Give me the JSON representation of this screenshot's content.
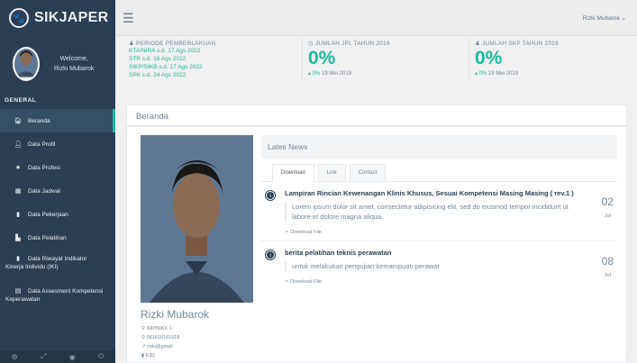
{
  "brand": {
    "title": "SIKJAPER"
  },
  "profile": {
    "welcome": "Welcome,",
    "name": "Rizki Mubarok"
  },
  "sidebar": {
    "section": "GENERAL",
    "items": [
      {
        "label": "Beranda",
        "icon": "home-icon"
      },
      {
        "label": "Data Profil",
        "icon": "user-icon"
      },
      {
        "label": "Data Profesi",
        "icon": "star-icon"
      },
      {
        "label": "Data Jadwal",
        "icon": "calendar-icon"
      },
      {
        "label": "Data Pekerjaan",
        "icon": "briefcase-icon"
      },
      {
        "label": "Data Pelatihan",
        "icon": "bookmark-icon"
      },
      {
        "label": "Data Riwayat Indikator Kinerja Individu (IKI)",
        "icon": "file-icon"
      },
      {
        "label": "Data Assesment Kompetensi Keperawatan",
        "icon": "file-text-icon"
      }
    ]
  },
  "topbar": {
    "user": "Rizki Mubarok ⌄"
  },
  "stats": {
    "periode": {
      "head": "PERIODE PEMBERLAKUAN",
      "lines": [
        "KTA/NIRA s.d. 17 Ags 2022",
        "STR s.d. 16 Ags 2022",
        "SIKP/SIKB s.d. 17 Ags 2022",
        "SPK s.d. 24 Ags 2022"
      ]
    },
    "jpl": {
      "head": "JUMLAH JPL TAHUN 2019",
      "value": "0%",
      "sub_change": "0%",
      "sub_date": "19 Mei 2019"
    },
    "skp": {
      "head": "JUMLAH SKP TAHUN 2019",
      "value": "0%",
      "sub_change": "0%",
      "sub_date": "19 Mei 2019"
    }
  },
  "main": {
    "title": "Beranda",
    "person": {
      "name": "Rizki Mubarok",
      "nip": "NIP/NIKK 1",
      "phone": "081818181818",
      "email": "rizki@gmail",
      "unit": "K3D"
    },
    "news": {
      "heading": "Lates News",
      "tabs": [
        "Download",
        "Link",
        "Contact"
      ],
      "articles": [
        {
          "title": "Lampiran Rincian Kewenangan Klinis Khusus, Sesuai Kompetensi Masing Masing ( rev.1 )",
          "body": "Lorem ipsum dolor sit amet, consectetur adipisicing elit, sed do eiusmod tempor incididunt ut labore et dolore magna aliqua.",
          "link": "Download File",
          "day": "02",
          "month": "Jul"
        },
        {
          "title": "berita pelatihan teknis perawatan",
          "body": "untuk melakukan pengujian kemampuan perawat",
          "link": "Download File",
          "day": "08",
          "month": "Jul"
        }
      ]
    }
  },
  "footer": {
    "icons": [
      "settings-icon",
      "fullscreen-icon",
      "eye-icon",
      "power-icon"
    ]
  },
  "colors": {
    "sidebar": "#2a3f54",
    "accent": "#1abb9c",
    "text": "#73879c"
  }
}
